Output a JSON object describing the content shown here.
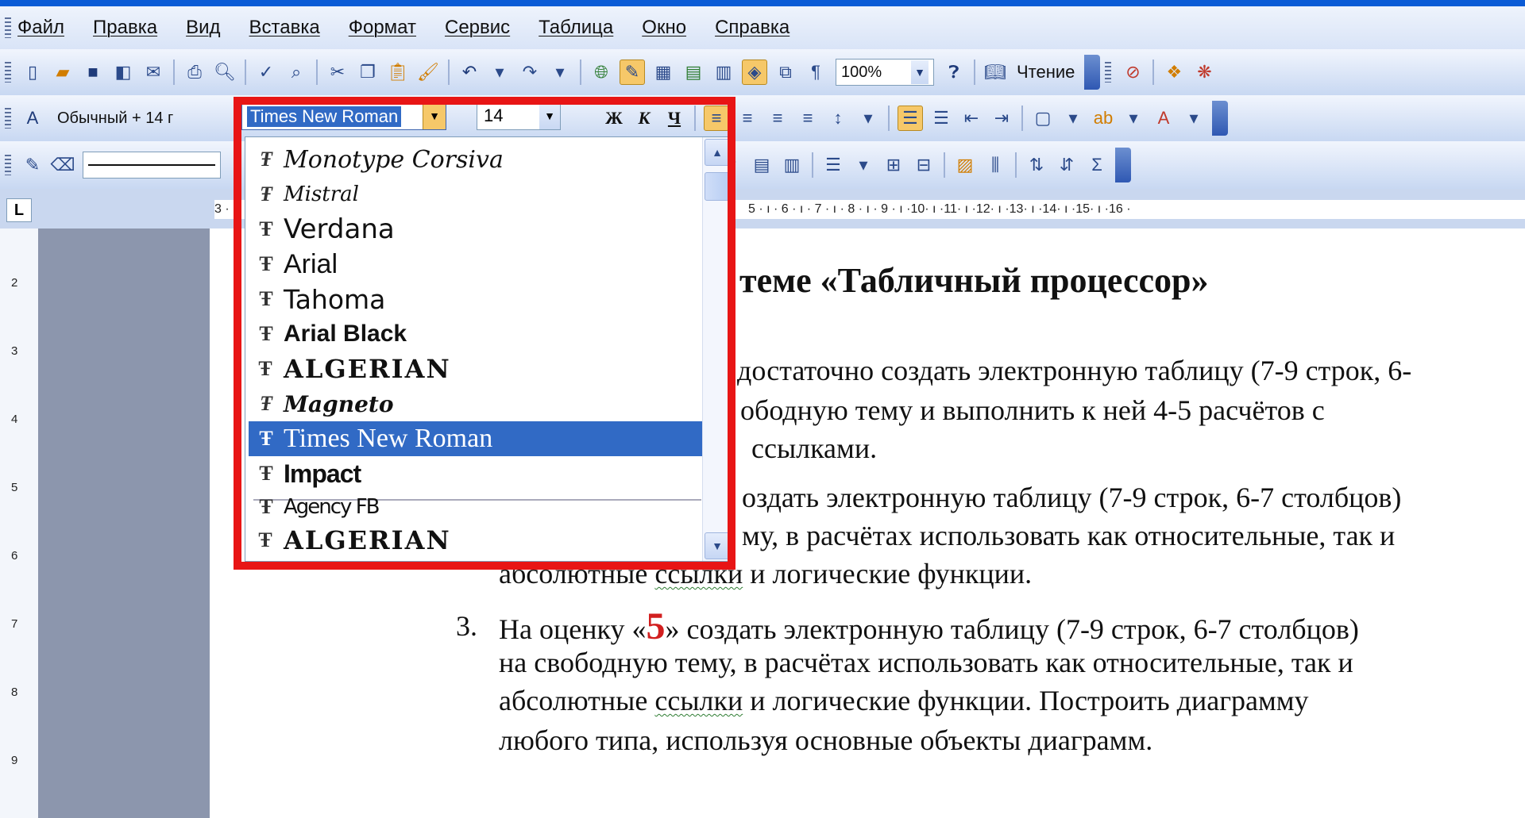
{
  "menubar": {
    "items": [
      "Файл",
      "Правка",
      "Вид",
      "Вставка",
      "Формат",
      "Сервис",
      "Таблица",
      "Окно",
      "Справка"
    ]
  },
  "toolbar_standard": {
    "zoom": "100%",
    "read_label": "Чтение"
  },
  "toolbar_format": {
    "style_value": "Обычный + 14 г",
    "font_value": "Times New Roman",
    "size_value": "14",
    "bold": "Ж",
    "italic": "К",
    "underline": "Ч"
  },
  "font_list": {
    "items": [
      {
        "label": "Monotype Corsiva"
      },
      {
        "label": "Mistral"
      },
      {
        "label": "Verdana"
      },
      {
        "label": "Arial"
      },
      {
        "label": "Tahoma"
      },
      {
        "label": "Arial Black"
      },
      {
        "label": "ALGERIAN"
      },
      {
        "label": "Magneto"
      },
      {
        "label": "Times New Roman",
        "selected": true
      },
      {
        "label": "Impact"
      },
      {
        "label": "Agency FB"
      },
      {
        "label": "ALGERIAN"
      }
    ]
  },
  "ruler": {
    "numbers": "3 · ",
    "numbers_right": "5 · ı · 6 · ı · 7 · ı · 8 · ı · 9 · ı ·10· ı ·11· ı ·12· ı ·13· ı ·14· ı ·15· ı ·16 ·"
  },
  "document": {
    "heading": "о теме «Табличный процессор»",
    "line1": "достаточно создать электронную таблицу (7-9 строк, 6-",
    "line2": "ободную тему  и выполнить к ней 4-5 расчётов с",
    "line3": "ссылками.",
    "line4": "оздать электронную таблицу (7-9 строк, 6-7 столбцов)",
    "line5": "му, в расчётах использовать как относительные, так и",
    "line6_pre": "абсолютные ",
    "line6_link": "ссылки",
    "line6_post": " и  логические функции.",
    "item3_num": "3.",
    "item3_pre": "На оценку «",
    "item3_grade": "5",
    "item3_post": "» создать электронную таблицу (7-9 строк, 6-7 столбцов)",
    "item3_line2": "на свободную тему, в расчётах использовать как относительные, так и",
    "item3_line3_pre": "абсолютные ",
    "item3_line3_link": "ссылки",
    "item3_line3_post": " и  логические функции. Построить  диаграмму",
    "item3_line4": "любого типа, используя основные объекты диаграмм."
  },
  "colors": {
    "highlight": "#e81515",
    "selection": "#316ac5",
    "grade_red": "#d21f1f"
  }
}
